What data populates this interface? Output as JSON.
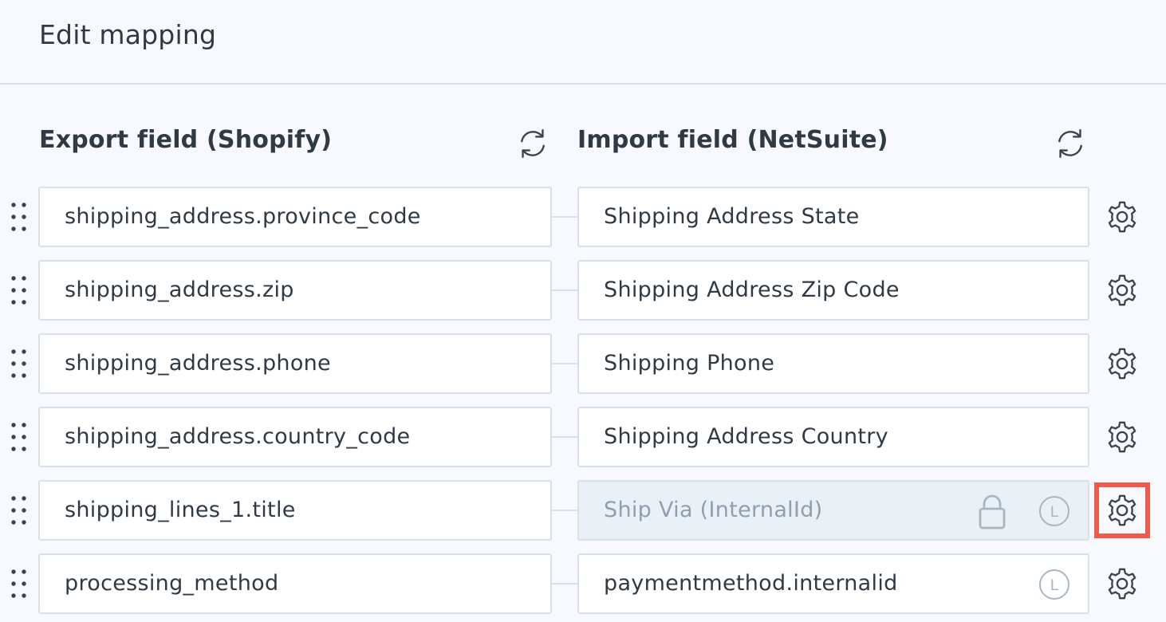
{
  "page": {
    "title": "Edit mapping"
  },
  "columns": {
    "export_header": "Export field (Shopify)",
    "import_header": "Import field (NetSuite)"
  },
  "icons": {
    "refresh": "refresh-icon",
    "settings": "gear-icon",
    "drag": "drag-handle-icon",
    "lock": "lock-icon",
    "lookup": "lookup-icon",
    "lookup_letter": "L"
  },
  "colors": {
    "background": "#f7f9fe",
    "text": "#2f3a44",
    "border": "#d8e1e8",
    "disabled_bg": "#e9f0f6",
    "disabled_text": "#8f9fae",
    "highlight": "#f05a4a"
  },
  "rows": [
    {
      "export": "shipping_address.province_code",
      "import": "Shipping Address State"
    },
    {
      "export": "shipping_address.zip",
      "import": "Shipping Address Zip Code"
    },
    {
      "export": "shipping_address.phone",
      "import": "Shipping Phone"
    },
    {
      "export": "shipping_address.country_code",
      "import": "Shipping Address Country"
    },
    {
      "export": "shipping_lines_1.title",
      "import": "Ship Via (InternalId)"
    },
    {
      "export": "processing_method",
      "import": "paymentmethod.internalid"
    }
  ]
}
